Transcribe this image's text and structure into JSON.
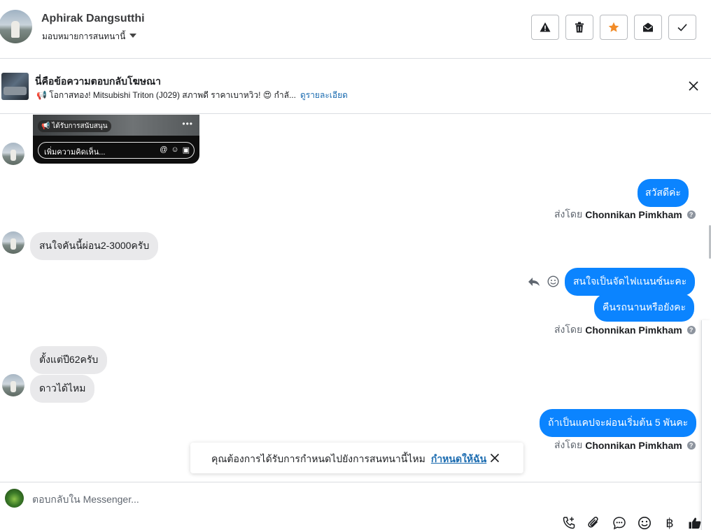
{
  "header": {
    "name": "Aphirak Dangsutthi",
    "assign_label": "มอบหมายการสนทนานี้"
  },
  "ad_banner": {
    "title": "นี่คือข้อความตอบกลับโฆษณา",
    "subtitle": "📢 โอกาสทอง! Mitsubishi Triton (J029) สภาพดี ราคาเบาหวิว! 😍 กำลั...",
    "details_link": "ดูรายละเอียด"
  },
  "ad_card": {
    "sponsored_label": "ได้รับการสนับสนุน",
    "comment_placeholder": "เพิ่มความคิดเห็น..."
  },
  "messages": {
    "out_1": "สวัสดีค่ะ",
    "sent_by_prefix": "ส่งโดย",
    "agent_name": "Chonnikan Pimkham",
    "in_1": "สนใจคันนี้ผ่อน2-3000ครับ",
    "out_2": "สนใจเป็นจัดไฟแนนซ์นะคะ",
    "out_3": "คืนรถนานหรือยังคะ",
    "in_2": "ตั้งแต่ปี62ครับ",
    "in_3": "ดาวได้ไหม",
    "out_4": "ถ้าเป็นแคปจะผ่อนเริ่มต้น 5 พันคะ"
  },
  "toast": {
    "text": "คุณต้องการได้รับการกำหนดไปยังการสนทนานี้ไหม",
    "link": "กำหนดให้ฉัน"
  },
  "composer": {
    "placeholder": "ตอบกลับใน Messenger...",
    "baht_symbol": "฿"
  },
  "colors": {
    "outgoing_bubble": "#0b84ff",
    "incoming_bubble": "#e9e9eb",
    "star_accent": "#f28c28",
    "link": "#1a6bb0"
  }
}
